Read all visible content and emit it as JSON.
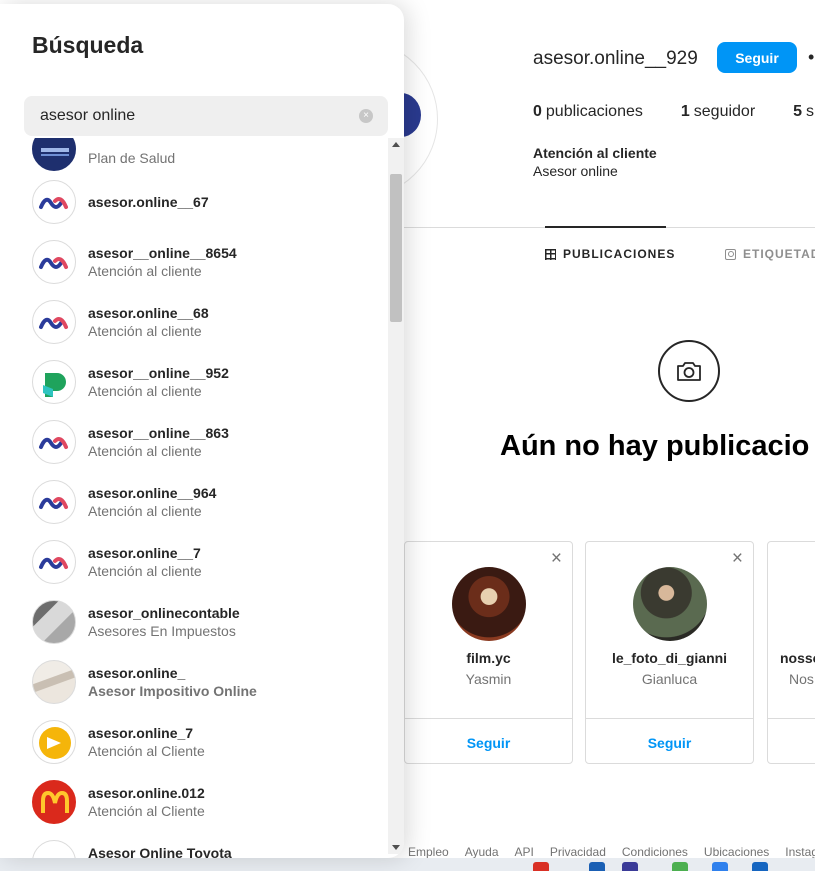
{
  "profile": {
    "username": "asesor.online__929",
    "follow_label": "Seguir",
    "more": "•",
    "stats": [
      {
        "count": "0",
        "label": "publicaciones"
      },
      {
        "count": "1",
        "label": "seguidor"
      },
      {
        "count": "5",
        "label": "s"
      }
    ],
    "bio_name": "Atención al cliente",
    "bio_text": "Asesor online"
  },
  "tabs": {
    "posts": "PUBLICACIONES",
    "tagged": "ETIQUETAD"
  },
  "empty_state": {
    "title": "Aún no hay publicacio"
  },
  "suggestions": [
    {
      "username": "film.yc",
      "name": "Yasmin",
      "follow": "Seguir",
      "close": "×"
    },
    {
      "username": "le_foto_di_gianni",
      "name": "Gianluca",
      "follow": "Seguir",
      "close": "×"
    },
    {
      "username": "nosso",
      "name": "Nos",
      "follow": "",
      "close": ""
    }
  ],
  "footer": [
    "Empleo",
    "Ayuda",
    "API",
    "Privacidad",
    "Condiciones",
    "Ubicaciones",
    "Instagra"
  ],
  "search": {
    "title": "Búsqueda",
    "query": "asesor online",
    "clear": "×"
  },
  "results": [
    {
      "username": "",
      "fullname": "Plan de Salud",
      "avatar": "sancor-logo"
    },
    {
      "username": "asesor.online__67",
      "fullname": "",
      "avatar": "wave-logo"
    },
    {
      "username": "asesor__online__8654",
      "fullname": "Atención al cliente",
      "avatar": "wave-logo"
    },
    {
      "username": "asesor.online__68",
      "fullname": "Atención al cliente",
      "avatar": "wave-logo"
    },
    {
      "username": "asesor__online__952",
      "fullname": "Atención al cliente",
      "avatar": "green-p-logo"
    },
    {
      "username": "asesor__online__863",
      "fullname": "Atención al cliente",
      "avatar": "wave-logo"
    },
    {
      "username": "asesor.online__964",
      "fullname": "Atención al cliente",
      "avatar": "wave-logo"
    },
    {
      "username": "asesor.online__7",
      "fullname": "Atención al cliente",
      "avatar": "wave-logo"
    },
    {
      "username": "asesor_onlinecontable",
      "fullname": "Asesores En Impuestos",
      "avatar": "photo-desk"
    },
    {
      "username": "asesor.online_",
      "fullname": "Asesor Impositivo Online",
      "avatar": "photo-papers"
    },
    {
      "username": "asesor.online_7",
      "fullname": "Atención al Cliente",
      "avatar": "yellow-b-logo"
    },
    {
      "username": "asesor.online.012",
      "fullname": "Atención al Cliente",
      "avatar": "mcdonalds-logo"
    },
    {
      "username": "Asesor Online Toyota",
      "fullname": "",
      "avatar": "blank"
    }
  ]
}
